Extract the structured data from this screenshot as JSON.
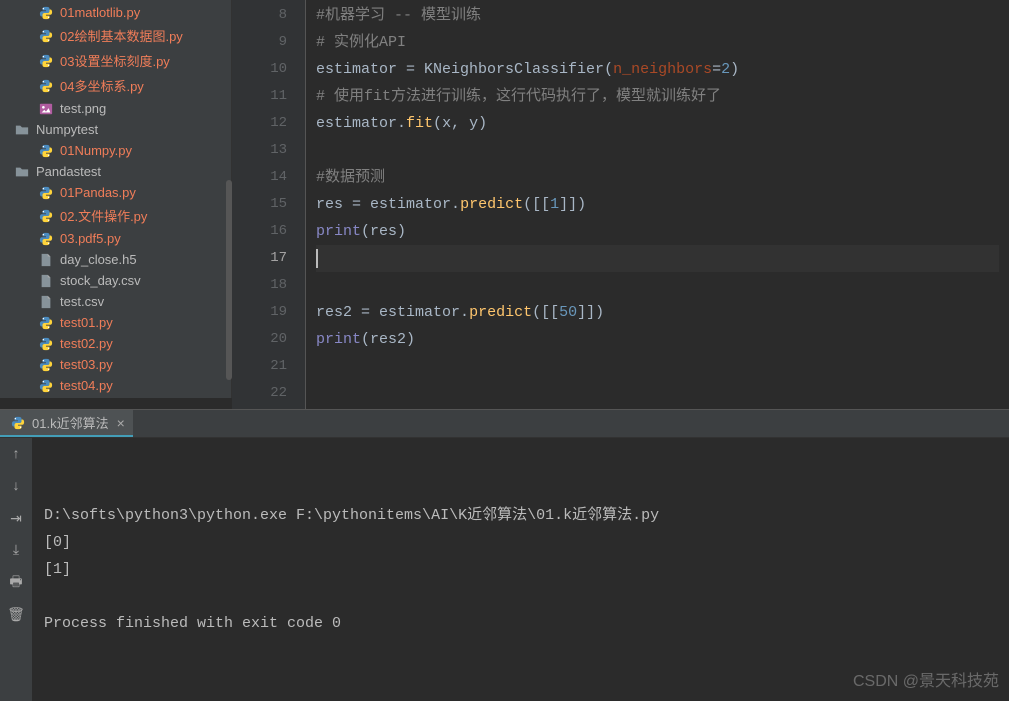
{
  "sidebar": {
    "items": [
      {
        "name": "01matlotlib.py",
        "type": "py",
        "indent": "file"
      },
      {
        "name": "02绘制基本数据图.py",
        "type": "py",
        "indent": "file"
      },
      {
        "name": "03设置坐标刻度.py",
        "type": "py",
        "indent": "file"
      },
      {
        "name": "04多坐标系.py",
        "type": "py",
        "indent": "file"
      },
      {
        "name": "test.png",
        "type": "img",
        "indent": "file"
      },
      {
        "name": "Numpytest",
        "type": "folder",
        "indent": "folder"
      },
      {
        "name": "01Numpy.py",
        "type": "py",
        "indent": "file"
      },
      {
        "name": "Pandastest",
        "type": "folder",
        "indent": "folder"
      },
      {
        "name": "01Pandas.py",
        "type": "py",
        "indent": "file"
      },
      {
        "name": "02.文件操作.py",
        "type": "py",
        "indent": "file"
      },
      {
        "name": "03.pdf5.py",
        "type": "py",
        "indent": "file"
      },
      {
        "name": "day_close.h5",
        "type": "h5",
        "indent": "file"
      },
      {
        "name": "stock_day.csv",
        "type": "csv",
        "indent": "file"
      },
      {
        "name": "test.csv",
        "type": "csv",
        "indent": "file"
      },
      {
        "name": "test01.py",
        "type": "py",
        "indent": "file"
      },
      {
        "name": "test02.py",
        "type": "py",
        "indent": "file"
      },
      {
        "name": "test03.py",
        "type": "py",
        "indent": "file"
      },
      {
        "name": "test04.py",
        "type": "py",
        "indent": "file"
      }
    ]
  },
  "editor": {
    "startLine": 8,
    "activeLine": 17,
    "lines": {
      "8": {
        "t": "comment",
        "text": "#机器学习 -- 模型训练"
      },
      "9": {
        "t": "comment",
        "text": "# 实例化API"
      },
      "10": {
        "t": "assign",
        "var": "estimator",
        "op": " = ",
        "cls": "KNeighborsClassifier",
        "lp": "(",
        "param": "n_neighbors",
        "eq": "=",
        "num": "2",
        "rp": ")"
      },
      "11": {
        "t": "comment",
        "text": "# 使用fit方法进行训练，这行代码执行了，模型就训练好了"
      },
      "12": {
        "t": "call",
        "obj": "estimator",
        "dot": ".",
        "method": "fit",
        "lp": "(",
        "args": "x, y",
        "rp": ")"
      },
      "13": {
        "t": "blank"
      },
      "14": {
        "t": "comment",
        "text": "#数据预测"
      },
      "15": {
        "t": "assign2",
        "var": "res",
        "op": " = ",
        "obj": "estimator",
        "dot": ".",
        "method": "predict",
        "lp": "(",
        "lb": "[[",
        "num": "1",
        "rb": "]]",
        "rp": ")"
      },
      "16": {
        "t": "print",
        "fn": "print",
        "lp": "(",
        "arg": "res",
        "rp": ")"
      },
      "17": {
        "t": "cursor"
      },
      "18": {
        "t": "blank"
      },
      "19": {
        "t": "assign2",
        "var": "res2",
        "op": " = ",
        "obj": "estimator",
        "dot": ".",
        "method": "predict",
        "lp": "(",
        "lb": "[[",
        "num": "50",
        "rb": "]]",
        "rp": ")"
      },
      "20": {
        "t": "print",
        "fn": "print",
        "lp": "(",
        "arg": "res2",
        "rp": ")"
      },
      "21": {
        "t": "blank"
      },
      "22": {
        "t": "blank"
      }
    }
  },
  "console": {
    "tabLabel": "01.k近邻算法",
    "lines": [
      "D:\\softs\\python3\\python.exe F:\\pythonitems\\AI\\K近邻算法\\01.k近邻算法.py",
      "[0]",
      "[1]",
      "",
      "Process finished with exit code 0"
    ]
  },
  "watermark": "CSDN @景天科技苑"
}
